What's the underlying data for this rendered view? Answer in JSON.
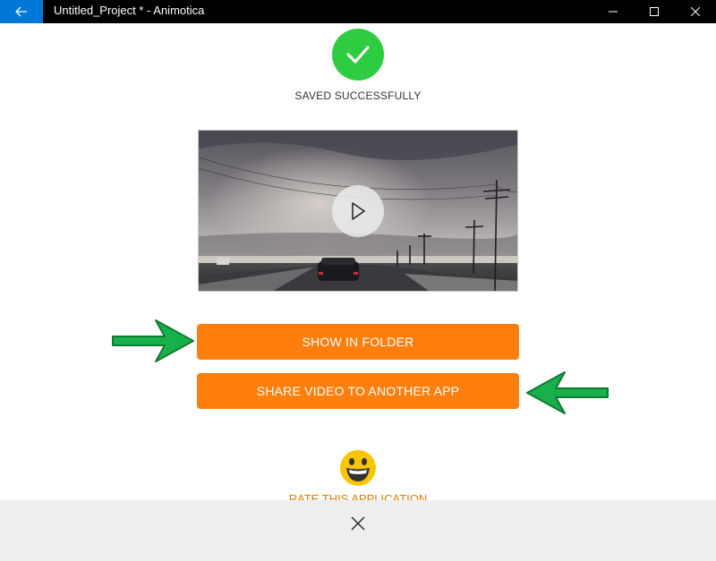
{
  "titlebar": {
    "title": "Untitled_Project * - Animotica",
    "back_icon": "arrow-left-icon",
    "minimize_icon": "minimize-icon",
    "maximize_icon": "maximize-icon",
    "close_icon": "close-icon"
  },
  "status": {
    "icon": "checkmark-icon",
    "label": "SAVED SUCCESSFULLY",
    "color": "#2ecc40"
  },
  "video": {
    "play_icon": "play-icon"
  },
  "actions": {
    "show_in_folder": "SHOW IN FOLDER",
    "share_video": "SHARE VIDEO TO ANOTHER APP",
    "button_color": "#ff7f0e",
    "arrow_color": "#18b04a"
  },
  "rating": {
    "icon": "smiley-face-icon",
    "label": "RATE THIS APPLICATION"
  },
  "bottom_bar": {
    "dismiss_icon": "close-icon"
  },
  "colors": {
    "accent": "#0078d7",
    "titlebar": "#000000"
  }
}
